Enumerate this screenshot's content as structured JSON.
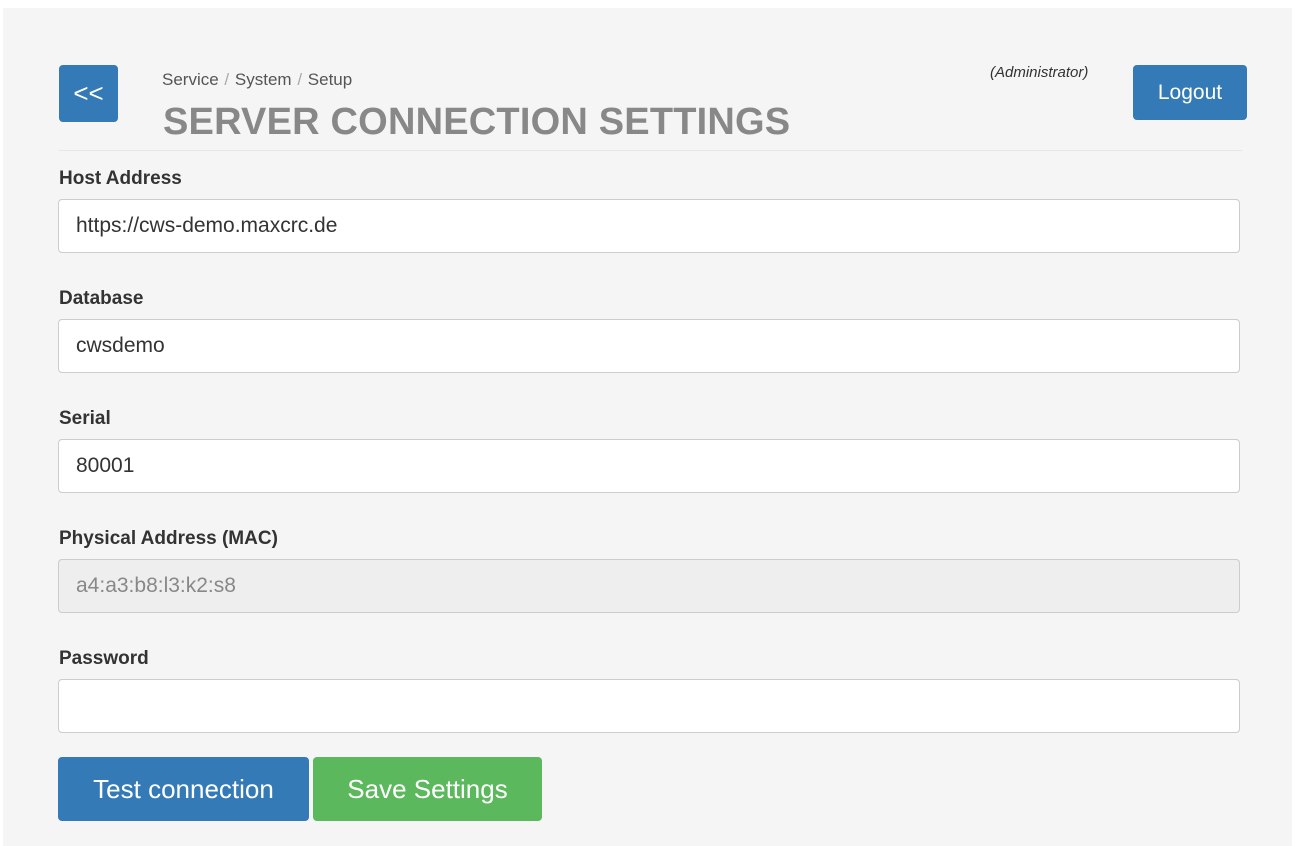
{
  "header": {
    "back_label": "<<",
    "breadcrumb": [
      "Service",
      "System",
      "Setup"
    ],
    "breadcrumb_separator": "/",
    "title": "SERVER CONNECTION SETTINGS",
    "user_role": "(Administrator)",
    "logout_label": "Logout"
  },
  "form": {
    "host": {
      "label": "Host Address",
      "value": "https://cws-demo.maxcrc.de"
    },
    "database": {
      "label": "Database",
      "value": "cwsdemo"
    },
    "serial": {
      "label": "Serial",
      "value": "80001"
    },
    "mac": {
      "label": "Physical Address (MAC)",
      "value": "a4:a3:b8:l3:k2:s8"
    },
    "password": {
      "label": "Password",
      "value": ""
    }
  },
  "actions": {
    "test_label": "Test connection",
    "save_label": "Save Settings"
  },
  "colors": {
    "primary": "#337ab7",
    "success": "#5cb85c",
    "panel_bg": "#f5f5f5",
    "title": "#888888"
  }
}
